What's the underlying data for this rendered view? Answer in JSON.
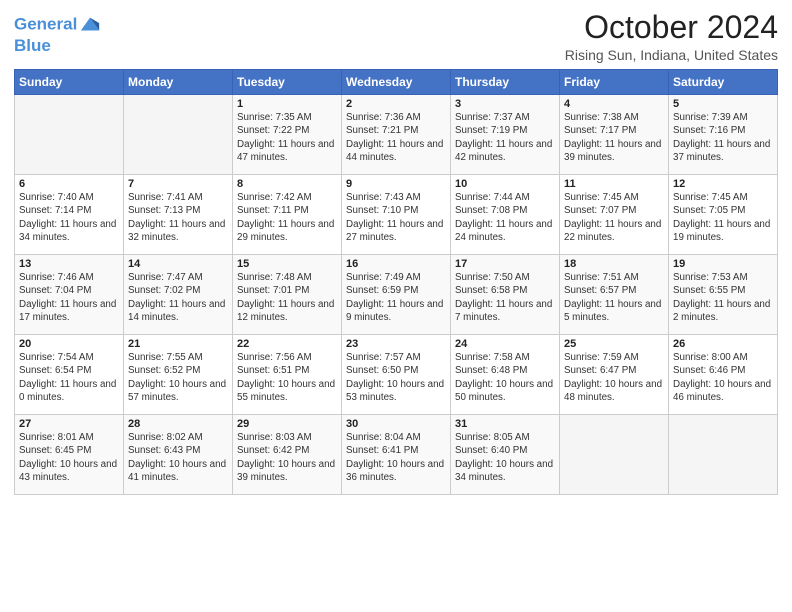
{
  "header": {
    "logo": {
      "line1": "General",
      "line2": "Blue"
    },
    "title": "October 2024",
    "subtitle": "Rising Sun, Indiana, United States"
  },
  "calendar": {
    "days_of_week": [
      "Sunday",
      "Monday",
      "Tuesday",
      "Wednesday",
      "Thursday",
      "Friday",
      "Saturday"
    ],
    "weeks": [
      [
        {
          "num": "",
          "info": ""
        },
        {
          "num": "",
          "info": ""
        },
        {
          "num": "1",
          "info": "Sunrise: 7:35 AM\nSunset: 7:22 PM\nDaylight: 11 hours and 47 minutes."
        },
        {
          "num": "2",
          "info": "Sunrise: 7:36 AM\nSunset: 7:21 PM\nDaylight: 11 hours and 44 minutes."
        },
        {
          "num": "3",
          "info": "Sunrise: 7:37 AM\nSunset: 7:19 PM\nDaylight: 11 hours and 42 minutes."
        },
        {
          "num": "4",
          "info": "Sunrise: 7:38 AM\nSunset: 7:17 PM\nDaylight: 11 hours and 39 minutes."
        },
        {
          "num": "5",
          "info": "Sunrise: 7:39 AM\nSunset: 7:16 PM\nDaylight: 11 hours and 37 minutes."
        }
      ],
      [
        {
          "num": "6",
          "info": "Sunrise: 7:40 AM\nSunset: 7:14 PM\nDaylight: 11 hours and 34 minutes."
        },
        {
          "num": "7",
          "info": "Sunrise: 7:41 AM\nSunset: 7:13 PM\nDaylight: 11 hours and 32 minutes."
        },
        {
          "num": "8",
          "info": "Sunrise: 7:42 AM\nSunset: 7:11 PM\nDaylight: 11 hours and 29 minutes."
        },
        {
          "num": "9",
          "info": "Sunrise: 7:43 AM\nSunset: 7:10 PM\nDaylight: 11 hours and 27 minutes."
        },
        {
          "num": "10",
          "info": "Sunrise: 7:44 AM\nSunset: 7:08 PM\nDaylight: 11 hours and 24 minutes."
        },
        {
          "num": "11",
          "info": "Sunrise: 7:45 AM\nSunset: 7:07 PM\nDaylight: 11 hours and 22 minutes."
        },
        {
          "num": "12",
          "info": "Sunrise: 7:45 AM\nSunset: 7:05 PM\nDaylight: 11 hours and 19 minutes."
        }
      ],
      [
        {
          "num": "13",
          "info": "Sunrise: 7:46 AM\nSunset: 7:04 PM\nDaylight: 11 hours and 17 minutes."
        },
        {
          "num": "14",
          "info": "Sunrise: 7:47 AM\nSunset: 7:02 PM\nDaylight: 11 hours and 14 minutes."
        },
        {
          "num": "15",
          "info": "Sunrise: 7:48 AM\nSunset: 7:01 PM\nDaylight: 11 hours and 12 minutes."
        },
        {
          "num": "16",
          "info": "Sunrise: 7:49 AM\nSunset: 6:59 PM\nDaylight: 11 hours and 9 minutes."
        },
        {
          "num": "17",
          "info": "Sunrise: 7:50 AM\nSunset: 6:58 PM\nDaylight: 11 hours and 7 minutes."
        },
        {
          "num": "18",
          "info": "Sunrise: 7:51 AM\nSunset: 6:57 PM\nDaylight: 11 hours and 5 minutes."
        },
        {
          "num": "19",
          "info": "Sunrise: 7:53 AM\nSunset: 6:55 PM\nDaylight: 11 hours and 2 minutes."
        }
      ],
      [
        {
          "num": "20",
          "info": "Sunrise: 7:54 AM\nSunset: 6:54 PM\nDaylight: 11 hours and 0 minutes."
        },
        {
          "num": "21",
          "info": "Sunrise: 7:55 AM\nSunset: 6:52 PM\nDaylight: 10 hours and 57 minutes."
        },
        {
          "num": "22",
          "info": "Sunrise: 7:56 AM\nSunset: 6:51 PM\nDaylight: 10 hours and 55 minutes."
        },
        {
          "num": "23",
          "info": "Sunrise: 7:57 AM\nSunset: 6:50 PM\nDaylight: 10 hours and 53 minutes."
        },
        {
          "num": "24",
          "info": "Sunrise: 7:58 AM\nSunset: 6:48 PM\nDaylight: 10 hours and 50 minutes."
        },
        {
          "num": "25",
          "info": "Sunrise: 7:59 AM\nSunset: 6:47 PM\nDaylight: 10 hours and 48 minutes."
        },
        {
          "num": "26",
          "info": "Sunrise: 8:00 AM\nSunset: 6:46 PM\nDaylight: 10 hours and 46 minutes."
        }
      ],
      [
        {
          "num": "27",
          "info": "Sunrise: 8:01 AM\nSunset: 6:45 PM\nDaylight: 10 hours and 43 minutes."
        },
        {
          "num": "28",
          "info": "Sunrise: 8:02 AM\nSunset: 6:43 PM\nDaylight: 10 hours and 41 minutes."
        },
        {
          "num": "29",
          "info": "Sunrise: 8:03 AM\nSunset: 6:42 PM\nDaylight: 10 hours and 39 minutes."
        },
        {
          "num": "30",
          "info": "Sunrise: 8:04 AM\nSunset: 6:41 PM\nDaylight: 10 hours and 36 minutes."
        },
        {
          "num": "31",
          "info": "Sunrise: 8:05 AM\nSunset: 6:40 PM\nDaylight: 10 hours and 34 minutes."
        },
        {
          "num": "",
          "info": ""
        },
        {
          "num": "",
          "info": ""
        }
      ]
    ]
  }
}
